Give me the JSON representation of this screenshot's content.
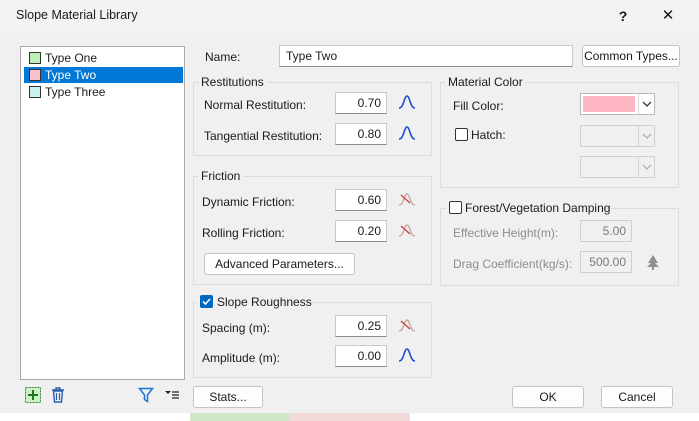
{
  "window": {
    "title": "Slope Material Library",
    "help_glyph": "?",
    "close_glyph": "✕"
  },
  "types": [
    {
      "label": "Type One",
      "color": "#bdf0b6",
      "selected": false
    },
    {
      "label": "Type Two",
      "color": "#f7c4cd",
      "selected": true
    },
    {
      "label": "Type Three",
      "color": "#c8f2f0",
      "selected": false
    }
  ],
  "name": {
    "label": "Name:",
    "value": "Type Two",
    "common_types_button": "Common Types..."
  },
  "restitutions": {
    "title": "Restitutions",
    "normal_label": "Normal Restitution:",
    "normal_value": "0.70",
    "tangential_label": "Tangential Restitution:",
    "tangential_value": "0.80"
  },
  "friction": {
    "title": "Friction",
    "dynamic_label": "Dynamic Friction:",
    "dynamic_value": "0.60",
    "rolling_label": "Rolling Friction:",
    "rolling_value": "0.20",
    "advanced_button": "Advanced Parameters..."
  },
  "roughness": {
    "title": "Slope Roughness",
    "checked": true,
    "spacing_label": "Spacing (m):",
    "spacing_value": "0.25",
    "amplitude_label": "Amplitude (m):",
    "amplitude_value": "0.00"
  },
  "material_color": {
    "title": "Material Color",
    "fill_label": "Fill Color:",
    "fill_color": "#ffb6c4",
    "hatch_label": "Hatch:",
    "hatch_checked": false
  },
  "damping": {
    "title": "Forest/Vegetation Damping",
    "checked": false,
    "height_label": "Effective Height(m):",
    "height_value": "5.00",
    "drag_label": "Drag Coefficient(kg/s):",
    "drag_value": "500.00"
  },
  "footer": {
    "stats_button": "Stats...",
    "ok_button": "OK",
    "cancel_button": "Cancel"
  },
  "colors": {
    "accent": "#0078d7",
    "icon_blue": "#1f4fd1",
    "icon_red": "#d04040"
  }
}
